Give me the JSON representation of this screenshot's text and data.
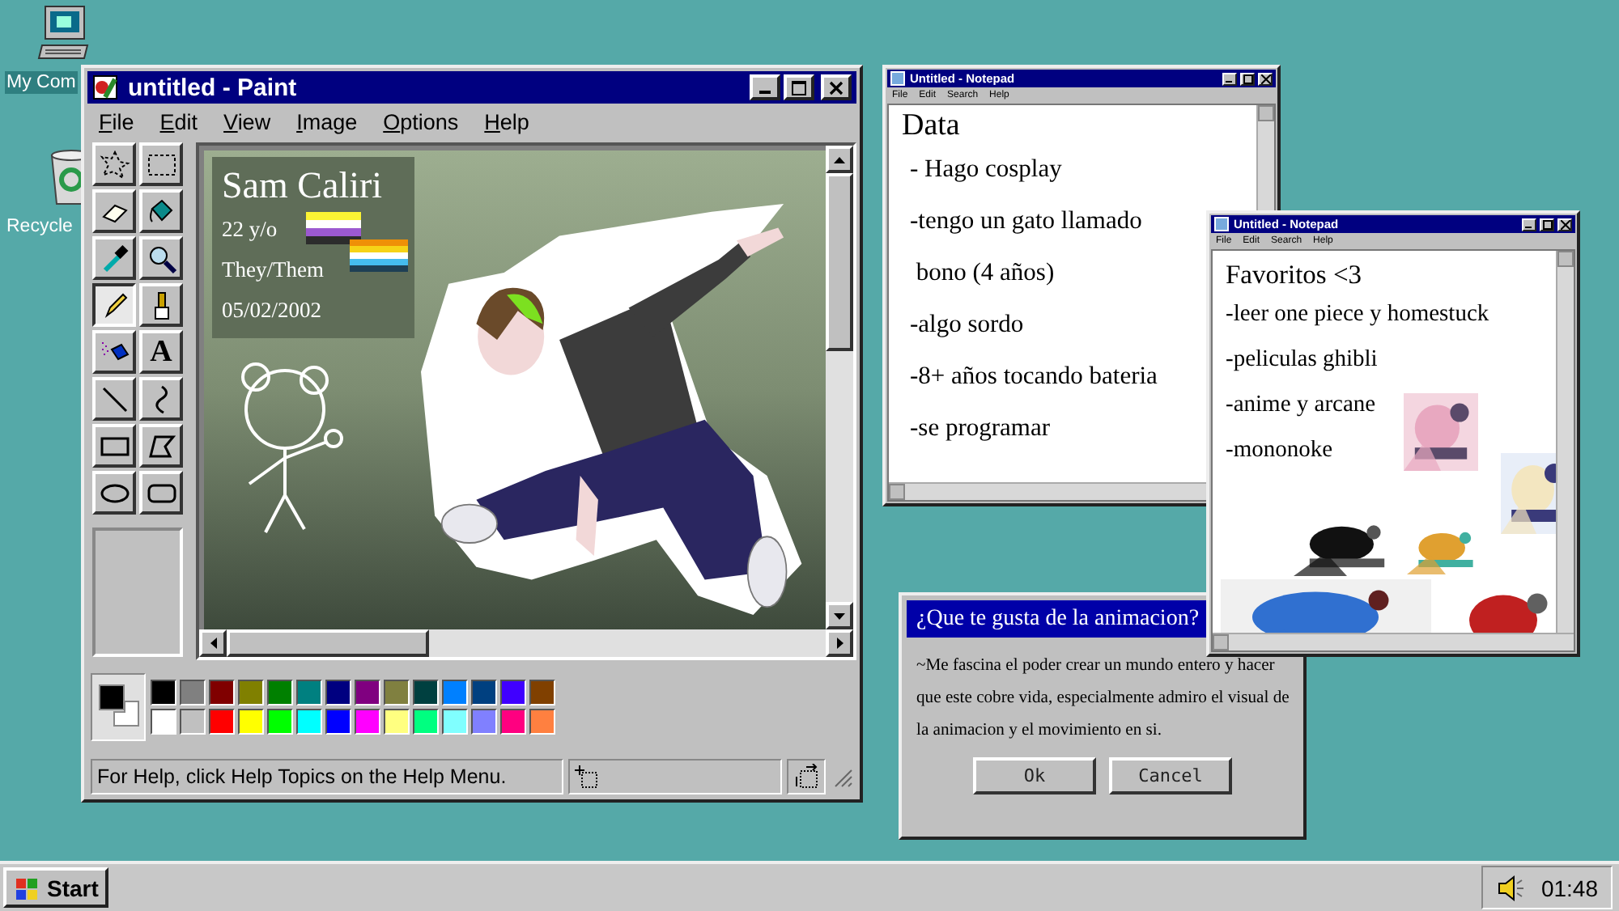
{
  "desktop_icons": [
    {
      "kind": "computer",
      "label": "My Com",
      "selected": true
    },
    {
      "kind": "recycle",
      "label": "Recycle",
      "selected": false
    }
  ],
  "paint": {
    "title": "untitled - Paint",
    "menu": [
      "File",
      "Edit",
      "View",
      "Image",
      "Options",
      "Help"
    ],
    "tools": [
      {
        "kind": "free-select",
        "selected": false
      },
      {
        "kind": "select",
        "selected": false
      },
      {
        "kind": "eraser",
        "selected": false
      },
      {
        "kind": "fill",
        "selected": false
      },
      {
        "kind": "picker",
        "selected": false
      },
      {
        "kind": "magnifier",
        "selected": false
      },
      {
        "kind": "pencil",
        "selected": true
      },
      {
        "kind": "brush",
        "selected": false
      },
      {
        "kind": "airbrush",
        "selected": false
      },
      {
        "kind": "text",
        "glyph": "A",
        "selected": false
      },
      {
        "kind": "line",
        "selected": false
      },
      {
        "kind": "curve",
        "selected": false
      },
      {
        "kind": "rectangle",
        "selected": false
      },
      {
        "kind": "polygon",
        "selected": false
      },
      {
        "kind": "ellipse",
        "selected": false
      },
      {
        "kind": "rounded-rectangle",
        "selected": false
      }
    ],
    "canvas": {
      "name": "Sam Caliri",
      "age": "22 y/o",
      "pronouns": "They/Them",
      "birthdate": "05/02/2002"
    },
    "current_colors": [
      {
        "color": "#000000"
      },
      {
        "color": "#ffffff"
      }
    ],
    "palette": [
      {
        "color": "#000000"
      },
      {
        "color": "#808080"
      },
      {
        "color": "#800000"
      },
      {
        "color": "#808000"
      },
      {
        "color": "#008000"
      },
      {
        "color": "#008080"
      },
      {
        "color": "#000080"
      },
      {
        "color": "#800080"
      },
      {
        "color": "#808040"
      },
      {
        "color": "#004040"
      },
      {
        "color": "#0080ff"
      },
      {
        "color": "#004080"
      },
      {
        "color": "#4000ff"
      },
      {
        "color": "#804000"
      },
      {
        "color": "#ffffff"
      },
      {
        "color": "#c0c0c0"
      },
      {
        "color": "#ff0000"
      },
      {
        "color": "#ffff00"
      },
      {
        "color": "#00ff00"
      },
      {
        "color": "#00ffff"
      },
      {
        "color": "#0000ff"
      },
      {
        "color": "#ff00ff"
      },
      {
        "color": "#ffff80"
      },
      {
        "color": "#00ff80"
      },
      {
        "color": "#80ffff"
      },
      {
        "color": "#8080ff"
      },
      {
        "color": "#ff0080"
      },
      {
        "color": "#ff8040"
      }
    ],
    "status_text": "For Help, click Help Topics on the Help Menu."
  },
  "notepads": [
    {
      "title": "Untitled - Notepad",
      "menu": [
        "File",
        "Edit",
        "Search",
        "Help"
      ],
      "heading": "Data",
      "lines": [
        "- Hago cosplay",
        "-tengo un gato llamado",
        " bono (4 años)",
        "-algo sordo",
        "-8+ años tocando bateria",
        "-se programar"
      ]
    },
    {
      "title": "Untitled - Notepad",
      "menu": [
        "File",
        "Edit",
        "Search",
        "Help"
      ],
      "heading": "Favoritos <3",
      "lines": [
        "-leer one piece y homestuck",
        "-peliculas ghibli",
        "-anime y arcane",
        "-mononoke"
      ]
    }
  ],
  "dialog": {
    "title": "¿Que te gusta de la animacion?",
    "message": "~Me fascina el poder crear un mundo entero y hacer que este cobre vida, especialmente admiro el visual de la animacion y el movimiento en si.",
    "buttons": [
      "Ok",
      "Cancel"
    ]
  },
  "taskbar": {
    "start": "Start",
    "clock": "01:48"
  }
}
